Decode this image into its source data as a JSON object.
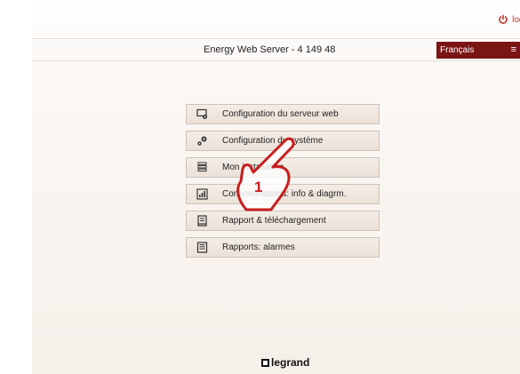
{
  "topbar": {
    "logout_label": "logo"
  },
  "header": {
    "title": "Energy Web Server - 4 149 48",
    "language": "Français"
  },
  "menu": {
    "items": [
      {
        "label": "Configuration du serveur web",
        "icon": "monitor-gear-icon"
      },
      {
        "label": "Configuration du système",
        "icon": "gears-icon"
      },
      {
        "label": "Mon installation",
        "icon": "layers-icon"
      },
      {
        "label": "Consommations: info & diagrm.",
        "icon": "chart-icon"
      },
      {
        "label": "Rapport & téléchargement",
        "icon": "report-download-icon"
      },
      {
        "label": "Rapports: alarmes",
        "icon": "list-icon"
      }
    ]
  },
  "annotation": {
    "step_number": "1"
  },
  "footer": {
    "brand": "legrand"
  },
  "colors": {
    "accent": "#7a1514",
    "logout": "#c0392b",
    "annotation": "#c81e1e"
  }
}
